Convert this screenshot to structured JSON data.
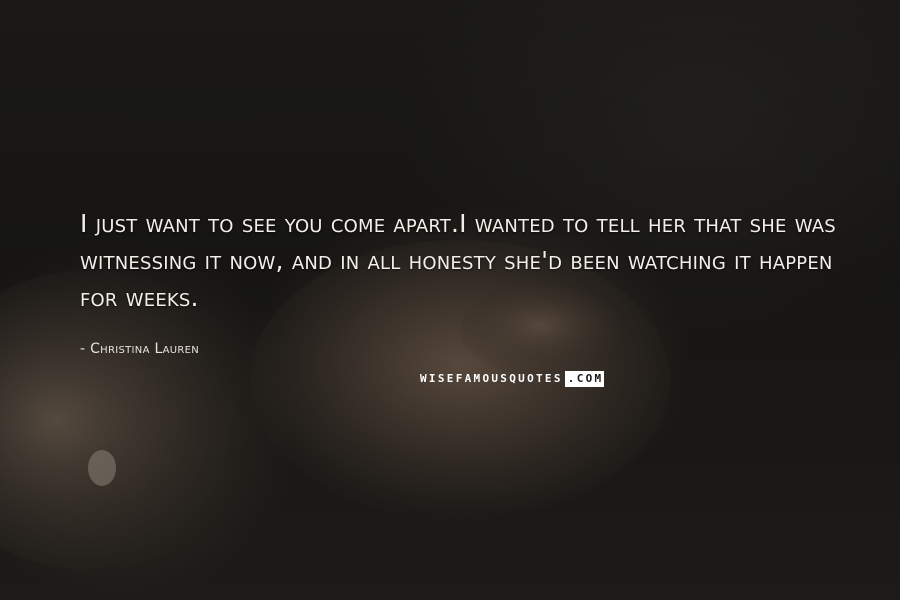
{
  "quote": {
    "text": "I just want to see you come apart.I wanted to tell her that she was witnessing it now, and in all honesty she'd been watching it happen for weeks."
  },
  "author": {
    "text": "- Christina Lauren"
  },
  "watermark": {
    "part1": "WISEFAMOUSQUOTES",
    "part2": ".COM"
  },
  "colors": {
    "background": "#161513",
    "text": "#f2efe9"
  }
}
